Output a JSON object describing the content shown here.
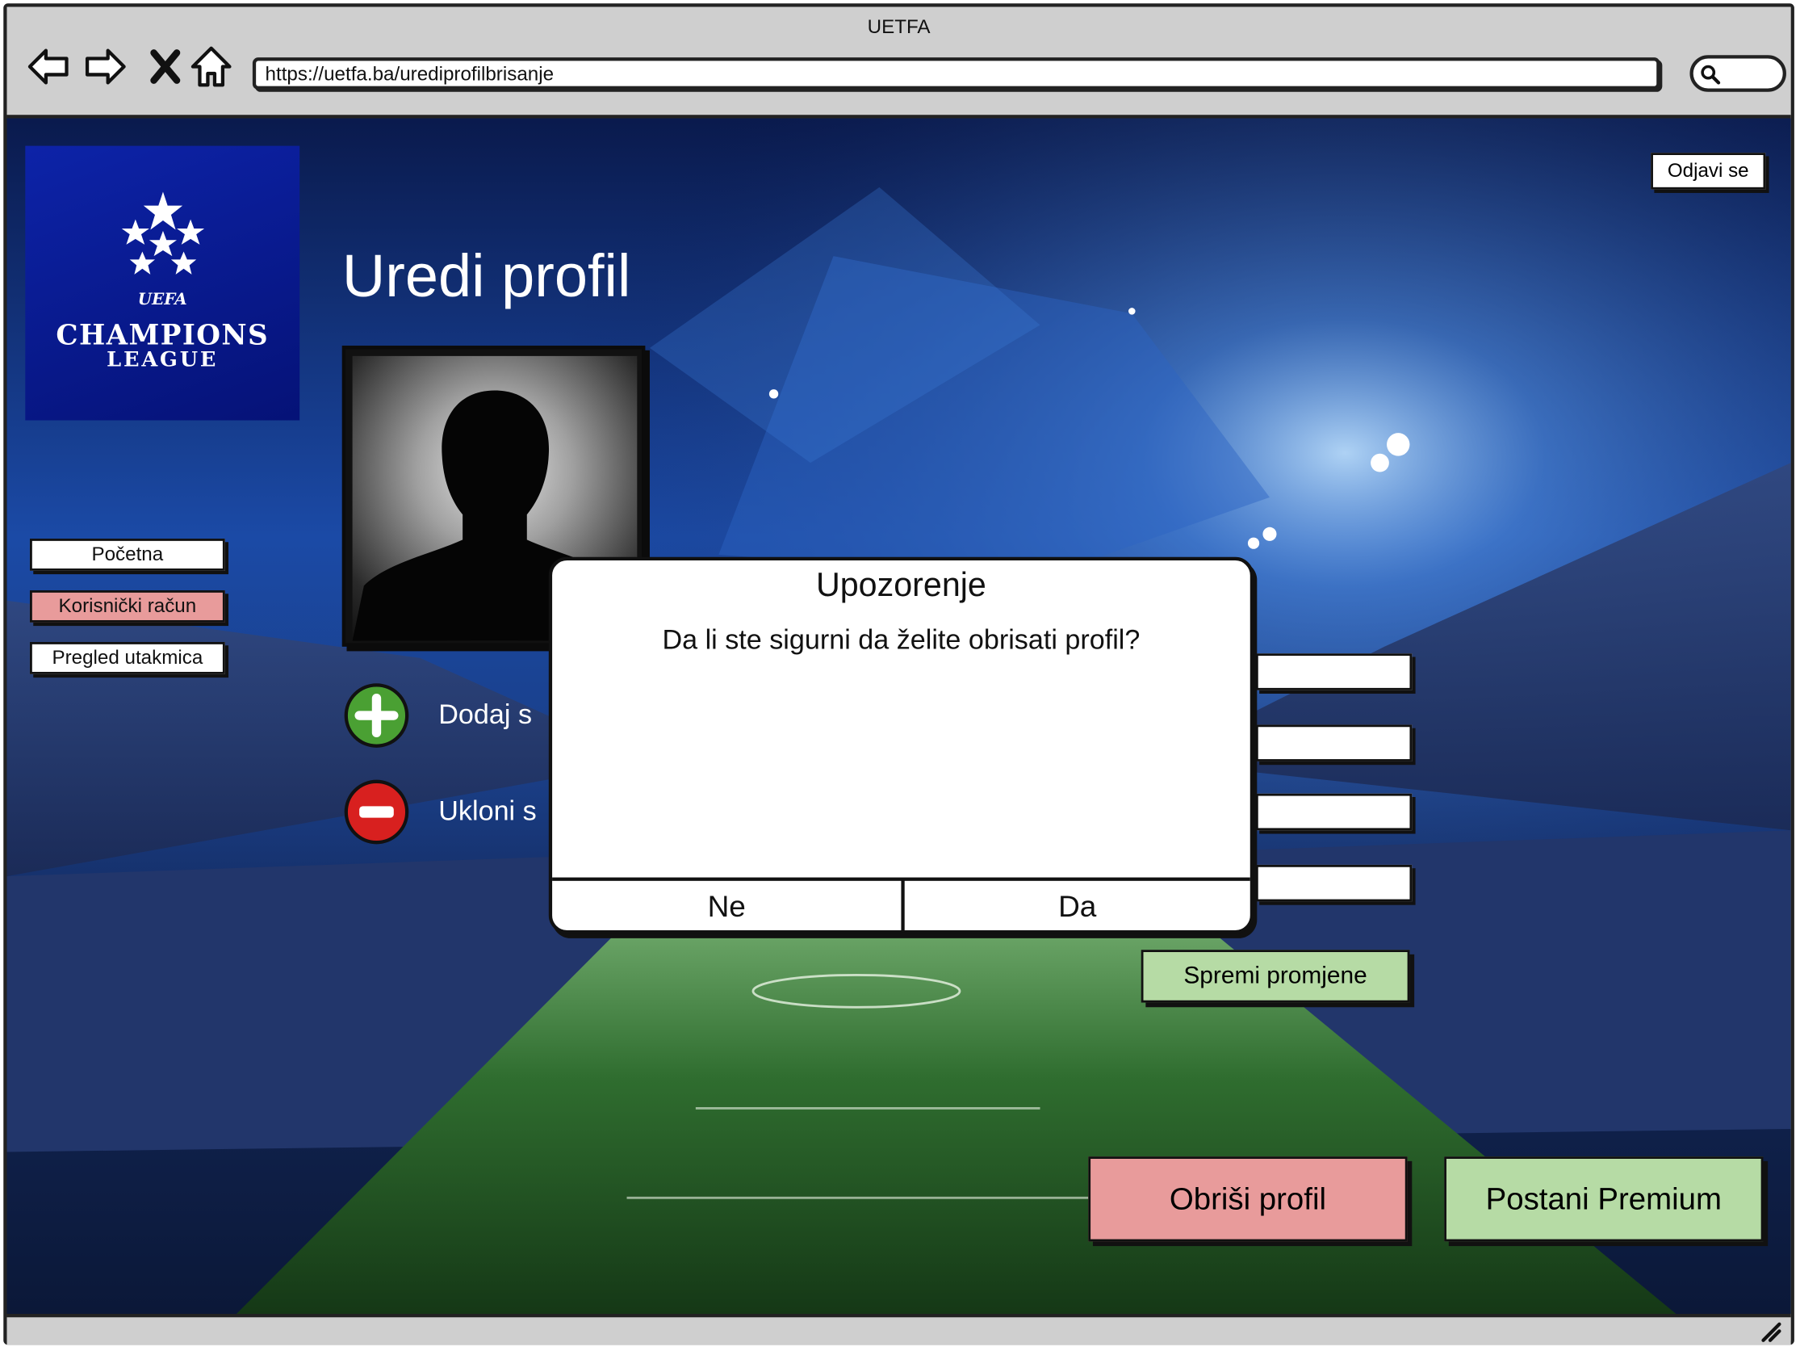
{
  "browser": {
    "title": "UETFA",
    "url": "https://uetfa.ba/urediprofilbrisanje"
  },
  "logo": {
    "uefa": "UEFA",
    "line1": "CHAMPIONS",
    "line2": "LEAGUE"
  },
  "header": {
    "logout_label": "Odjavi se",
    "page_title": "Uredi profil"
  },
  "sidebar": {
    "items": [
      {
        "label": "Početna"
      },
      {
        "label": "Korisnički račun"
      },
      {
        "label": "Pregled utakmica"
      }
    ]
  },
  "photo_actions": {
    "add_label": "Dodaj s",
    "remove_label": "Ukloni s"
  },
  "form": {
    "save_label": "Spremi promjene"
  },
  "actions": {
    "delete_label": "Obriši profil",
    "premium_label": "Postani Premium"
  },
  "dialog": {
    "title": "Upozorenje",
    "message": "Da li ste sigurni da želite obrisati profil?",
    "no_label": "Ne",
    "yes_label": "Da"
  },
  "colors": {
    "active_nav": "#e89b9b",
    "delete": "#e89b9b",
    "save": "#b6dba5",
    "premium": "#b6dba5",
    "add_icon": "#4aa033",
    "remove_icon": "#d8201f"
  }
}
